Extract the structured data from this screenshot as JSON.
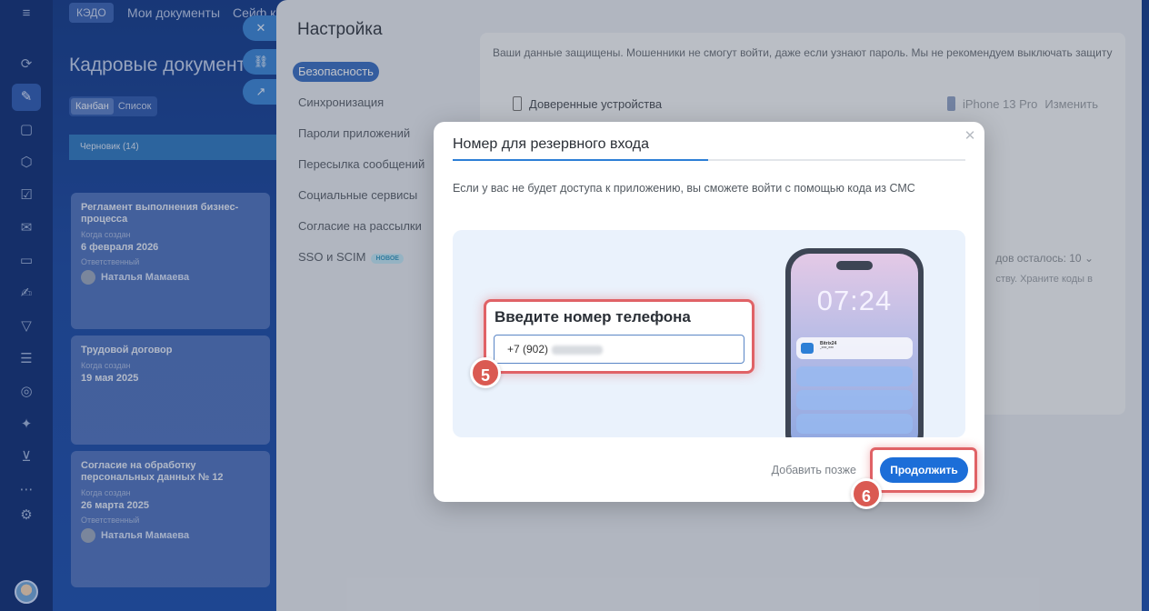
{
  "app": {
    "top_tabs": [
      "КЭДО",
      "Мои документы",
      "Сейф ко"
    ],
    "page_title": "Кадровые документ",
    "view_switch": [
      "Канбан",
      "Список"
    ],
    "column": {
      "name": "Черновик",
      "count": "(14)"
    },
    "cards": [
      {
        "title": "Регламент выполнения бизнес-процесса",
        "created_label": "Когда создан",
        "created": "6 февраля 2026",
        "resp_label": "Ответственный",
        "person": "Наталья Мамаева"
      },
      {
        "title": "Трудовой договор",
        "created_label": "Когда создан",
        "created": "19 мая 2025"
      },
      {
        "title": "Согласие на обработку персональных данных № 12",
        "created_label": "Когда создан",
        "created": "26 марта 2025",
        "resp_label": "Ответственный",
        "person": "Наталья Мамаева"
      }
    ],
    "float_icons": [
      "close-icon",
      "link-icon",
      "external-icon"
    ]
  },
  "settings": {
    "title": "Настройка",
    "menu": [
      {
        "label": "Безопасность",
        "active": true
      },
      {
        "label": "Синхронизация"
      },
      {
        "label": "Пароли приложений"
      },
      {
        "label": "Пересылка сообщений"
      },
      {
        "label": "Социальные сервисы"
      },
      {
        "label": "Согласие на рассылки"
      },
      {
        "label": "SSO и SCIM",
        "badge": "НОВОЕ"
      }
    ],
    "protect_text": "Ваши данные защищены. Мошенники не смогут войти, даже если узнают пароль. Мы не рекомендуем выключать защиту",
    "trusted_devices": "Доверенные устройства",
    "device": "iPhone 13 Pro",
    "change": "Изменить",
    "codes_left": "дов осталось: 10",
    "codes_hint": "ству. Храните коды в"
  },
  "modal": {
    "title": "Номер для резервного входа",
    "description": "Если у вас не будет доступа к приложению, вы сможете войти с помощью кода из СМС",
    "phone_label": "Введите номер телефона",
    "phone_value": "+7 (902)",
    "step_phone": "5",
    "step_continue": "6",
    "phone_time": "07:24",
    "notif_title": "Bitrix24",
    "notif_text": "-***-***",
    "later": "Добавить позже",
    "continue": "Продолжить"
  }
}
